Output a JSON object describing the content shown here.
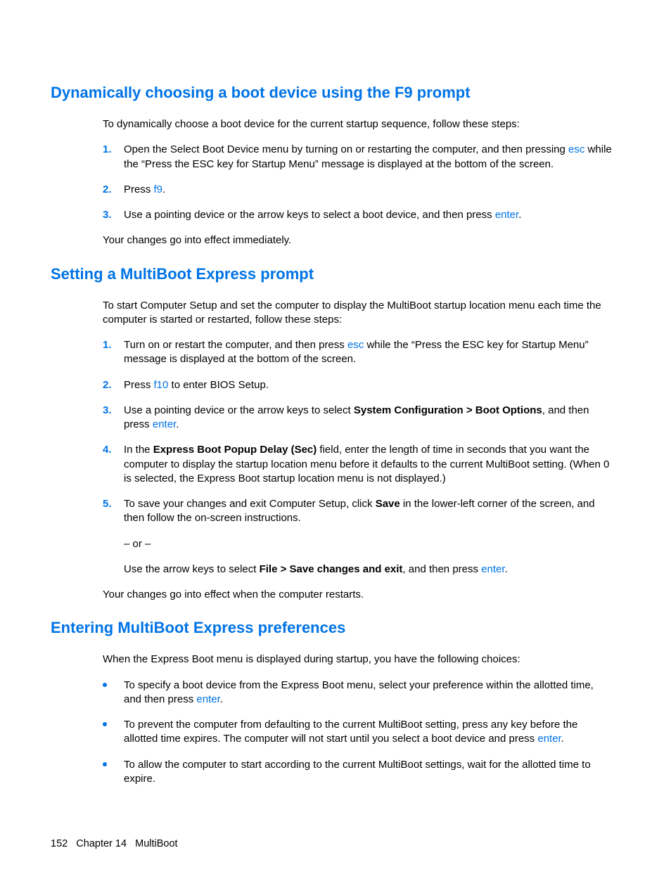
{
  "section1": {
    "heading": "Dynamically choosing a boot device using the F9 prompt",
    "intro": "To dynamically choose a boot device for the current startup sequence, follow these steps:",
    "steps": [
      {
        "num": "1.",
        "pre": "Open the Select Boot Device menu by turning on or restarting the computer, and then pressing ",
        "key": "esc",
        "post": " while the “Press the ESC key for Startup Menu” message is displayed at the bottom of the screen."
      },
      {
        "num": "2.",
        "pre": "Press ",
        "key": "f9",
        "post": "."
      },
      {
        "num": "3.",
        "pre": "Use a pointing device or the arrow keys to select a boot device, and then press ",
        "key": "enter",
        "post": "."
      }
    ],
    "outro": "Your changes go into effect immediately."
  },
  "section2": {
    "heading": "Setting a MultiBoot Express prompt",
    "intro": "To start Computer Setup and set the computer to display the MultiBoot startup location menu each time the computer is started or restarted, follow these steps:",
    "step1": {
      "num": "1.",
      "pre": "Turn on or restart the computer, and then press ",
      "key": "esc",
      "post": " while the “Press the ESC key for Startup Menu” message is displayed at the bottom of the screen."
    },
    "step2": {
      "num": "2.",
      "pre": "Press ",
      "key": "f10",
      "post": " to enter BIOS Setup."
    },
    "step3": {
      "num": "3.",
      "pre": "Use a pointing device or the arrow keys to select ",
      "bold": "System Configuration > Boot Options",
      "mid": ", and then press ",
      "key": "enter",
      "post": "."
    },
    "step4": {
      "num": "4.",
      "pre": "In the ",
      "bold": "Express Boot Popup Delay (Sec)",
      "post": " field, enter the length of time in seconds that you want the computer to display the startup location menu before it defaults to the current MultiBoot setting. (When 0 is selected, the Express Boot startup location menu is not displayed.)"
    },
    "step5": {
      "num": "5.",
      "pre": "To save your changes and exit Computer Setup, click ",
      "bold": "Save",
      "post": " in the lower-left corner of the screen, and then follow the on-screen instructions."
    },
    "or": "– or –",
    "alt": {
      "pre": "Use the arrow keys to select ",
      "bold": "File > Save changes and exit",
      "mid": ", and then press ",
      "key": "enter",
      "post": "."
    },
    "outro": "Your changes go into effect when the computer restarts."
  },
  "section3": {
    "heading": "Entering MultiBoot Express preferences",
    "intro": "When the Express Boot menu is displayed during startup, you have the following choices:",
    "bullet1": {
      "pre": "To specify a boot device from the Express Boot menu, select your preference within the allotted time, and then press ",
      "key": "enter",
      "post": "."
    },
    "bullet2": {
      "pre": "To prevent the computer from defaulting to the current MultiBoot setting, press any key before the allotted time expires. The computer will not start until you select a boot device and press ",
      "key": "enter",
      "post": "."
    },
    "bullet3": {
      "text": "To allow the computer to start according to the current MultiBoot settings, wait for the allotted time to expire."
    }
  },
  "footer": {
    "page": "152",
    "chapter": "Chapter 14",
    "title": "MultiBoot"
  }
}
